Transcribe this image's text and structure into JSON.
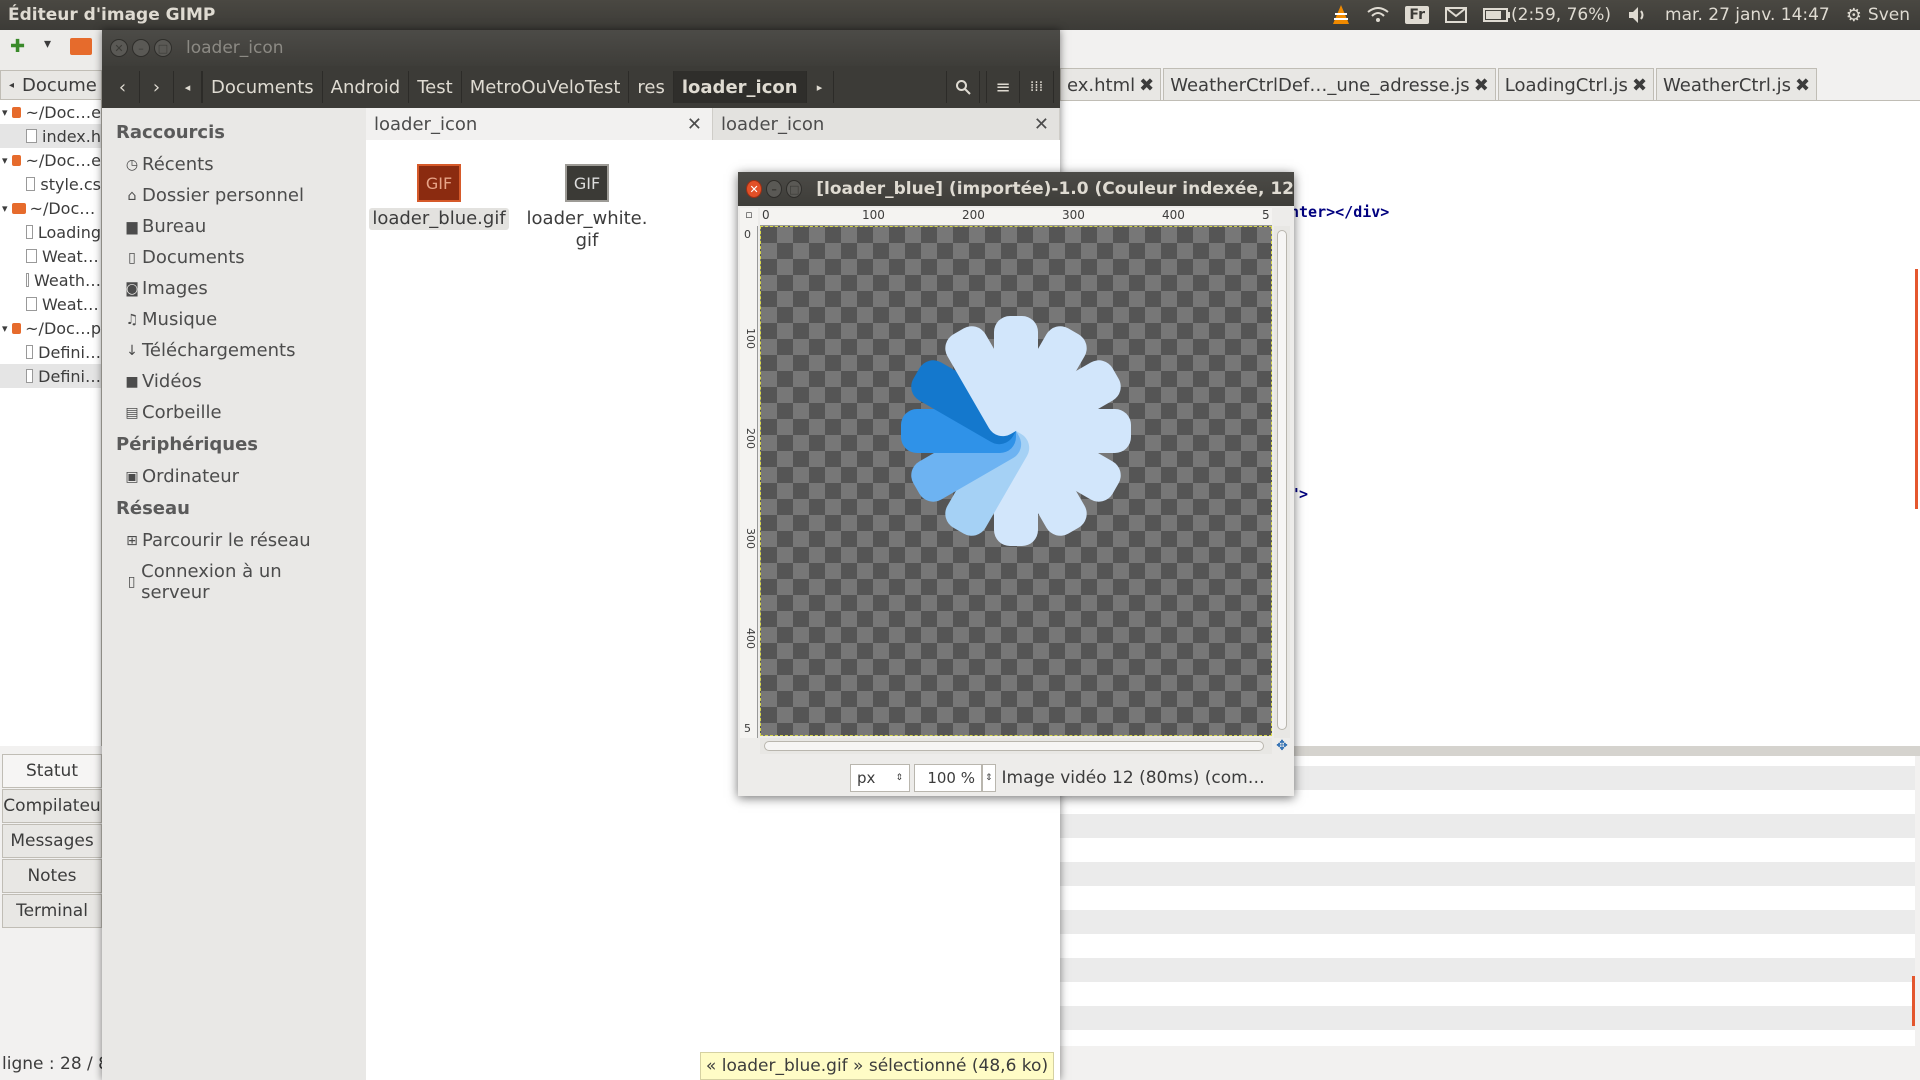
{
  "panel": {
    "app_title": "Éditeur d'image GIMP",
    "keyboard": "Fr",
    "battery": "(2:59, 76%)",
    "datetime": "mar. 27 janv. 14:47",
    "user": "Sven"
  },
  "geany": {
    "sidebar_tab": "Docume",
    "tree": [
      {
        "label": "~/Doc…e",
        "type": "folder"
      },
      {
        "label": "index.h",
        "type": "file",
        "selected": true
      },
      {
        "label": "~/Doc…e",
        "type": "folder"
      },
      {
        "label": "style.cs",
        "type": "file"
      },
      {
        "label": "~/Doc…",
        "type": "folder"
      },
      {
        "label": "Loading",
        "type": "file"
      },
      {
        "label": "Weat…",
        "type": "file"
      },
      {
        "label": "Weath…",
        "type": "file"
      },
      {
        "label": "Weat…",
        "type": "file"
      },
      {
        "label": "~/Doc…p",
        "type": "folder"
      },
      {
        "label": "Defini…",
        "type": "file"
      },
      {
        "label": "Defini…",
        "type": "file",
        "selected": true
      }
    ],
    "editor_tabs": [
      "ex.html",
      "WeatherCtrlDef…_une_adresse.js",
      "LoadingCtrl.js",
      "WeatherCtrl.js"
    ],
    "code_fragments": [
      "nter></div>",
      "\">"
    ],
    "bottom_tabs": [
      "Statut",
      "Compilateu",
      "Messages",
      "Notes",
      "Terminal"
    ],
    "status_line": "ligne : 28 / 8"
  },
  "nautilus": {
    "title": "loader_icon",
    "breadcrumbs": [
      "Documents",
      "Android",
      "Test",
      "MetroOuVeloTest",
      "res",
      "loader_icon"
    ],
    "sections": [
      {
        "heading": "Raccourcis",
        "items": [
          {
            "label": "Récents",
            "icon": "clock-icon"
          },
          {
            "label": "Dossier personnel",
            "icon": "home-icon"
          },
          {
            "label": "Bureau",
            "icon": "desktop-icon"
          },
          {
            "label": "Documents",
            "icon": "document-icon"
          },
          {
            "label": "Images",
            "icon": "camera-icon"
          },
          {
            "label": "Musique",
            "icon": "music-icon"
          },
          {
            "label": "Téléchargements",
            "icon": "download-icon"
          },
          {
            "label": "Vidéos",
            "icon": "video-icon"
          },
          {
            "label": "Corbeille",
            "icon": "trash-icon"
          }
        ]
      },
      {
        "heading": "Périphériques",
        "items": [
          {
            "label": "Ordinateur",
            "icon": "computer-icon"
          }
        ]
      },
      {
        "heading": "Réseau",
        "items": [
          {
            "label": "Parcourir le réseau",
            "icon": "network-icon"
          },
          {
            "label": "Connexion à un serveur",
            "icon": "server-icon"
          }
        ]
      }
    ],
    "tabs": [
      "loader_icon",
      "loader_icon"
    ],
    "files": [
      {
        "name": "loader_blue.gif",
        "badge": "GIF",
        "selected": true
      },
      {
        "name": "loader_white.\ngif",
        "badge": "GIF",
        "selected": false
      }
    ],
    "status": "« loader_blue.gif » sélectionné (48,6 ko)"
  },
  "gimp": {
    "title": "[loader_blue] (importée)-1.0 (Couleur indexée, 12",
    "ruler_top": [
      "0",
      "100",
      "200",
      "300",
      "400",
      "5"
    ],
    "ruler_left": [
      "0",
      "100",
      "200",
      "300",
      "400",
      "5"
    ],
    "unit": "px",
    "zoom": "100 %",
    "status": "Image vidéo 12 (80ms) (com…",
    "spinner_colors": [
      "#d2e6fb",
      "#d2e6fb",
      "#d2e6fb",
      "#d2e6fb",
      "#d2e6fb",
      "#d2e6fb",
      "#d2e6fb",
      "#a5d1f5",
      "#6db3f2",
      "#2f92e8",
      "#1478cd",
      "#d2e6fb"
    ]
  }
}
